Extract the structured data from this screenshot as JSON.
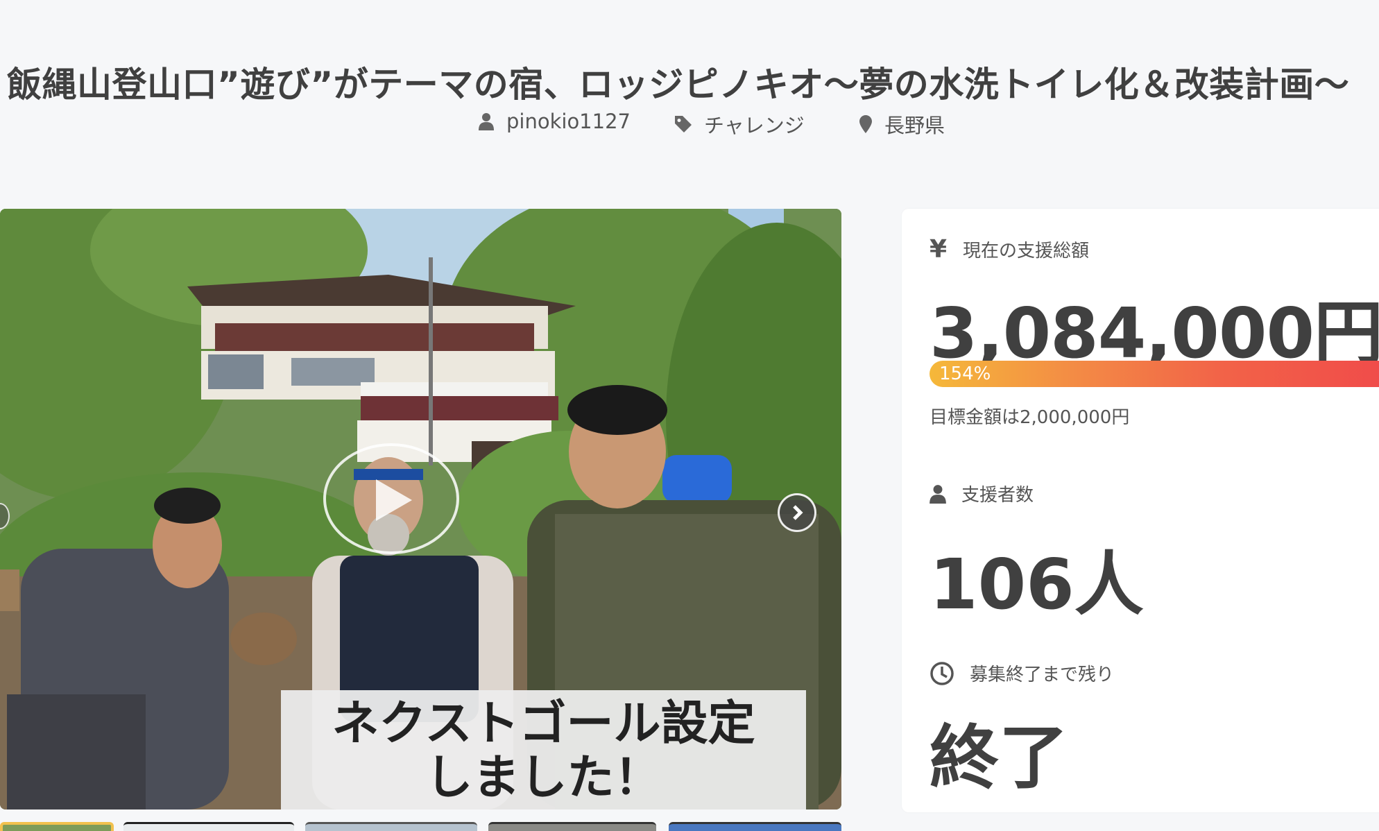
{
  "project": {
    "title": "飯縄山登山口”遊び”がテーマの宿、ロッジピノキオ〜夢の水洗トイレ化＆改装計画〜",
    "owner": "pinokio1127",
    "category": "チャレンジ",
    "location": "長野県"
  },
  "media": {
    "caption_line1": "ネクストゴール設定",
    "caption_line2": "しました！",
    "thumbnail_count": 5,
    "active_thumbnail": 1
  },
  "stats": {
    "total_label": "現在の支援総額",
    "total_symbol": "¥",
    "total_amount": "3,084,000円",
    "progress_percent": 154,
    "progress_label": "154%",
    "goal_text": "目標金額は2,000,000円",
    "backers_label": "支援者数",
    "backers_value": "106人",
    "remaining_label": "募集終了まで残り",
    "remaining_value": "終了"
  },
  "colors": {
    "progress_start": "#f5b83a",
    "progress_end": "#f0474a",
    "thumbnail_active": "#f2c14e",
    "page_background": "#f6f7f9"
  },
  "icons": [
    "user-icon",
    "tag-icon",
    "location-pin-icon",
    "yen-icon",
    "clock-icon",
    "play-icon",
    "chevron-right-icon",
    "chevron-left-icon"
  ]
}
